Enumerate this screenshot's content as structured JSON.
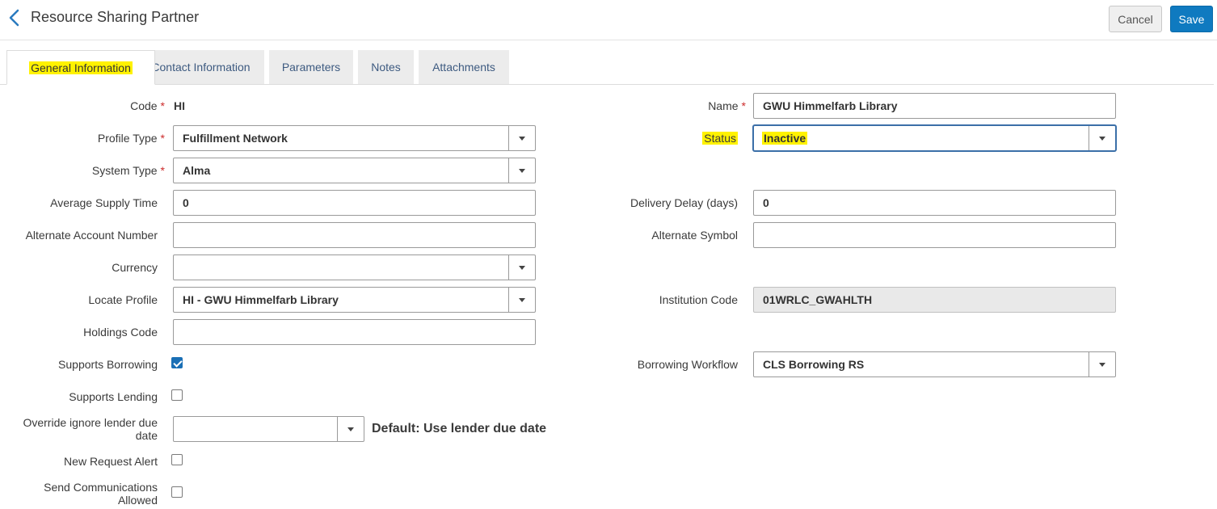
{
  "header": {
    "title": "Resource Sharing Partner",
    "back_icon": "chevron-left-icon",
    "cancel_label": "Cancel",
    "save_label": "Save"
  },
  "tabs": [
    {
      "label": "General Information",
      "active": true
    },
    {
      "label": "Contact Information"
    },
    {
      "label": "Parameters"
    },
    {
      "label": "Notes"
    },
    {
      "label": "Attachments"
    }
  ],
  "form": {
    "code": {
      "label": "Code",
      "value": "HI",
      "required": "*"
    },
    "name": {
      "label": "Name",
      "value": "GWU Himmelfarb Library",
      "required": "*"
    },
    "profile_type": {
      "label": "Profile Type",
      "value": "Fulfillment Network",
      "required": "*"
    },
    "status": {
      "label": "Status",
      "value": "Inactive"
    },
    "system_type": {
      "label": "System Type",
      "value": "Alma",
      "required": "*"
    },
    "average_supply_time": {
      "label": "Average Supply Time",
      "value": "0"
    },
    "delivery_delay": {
      "label": "Delivery Delay (days)",
      "value": "0"
    },
    "alternate_account_number": {
      "label": "Alternate Account Number",
      "value": ""
    },
    "alternate_symbol": {
      "label": "Alternate Symbol",
      "value": ""
    },
    "currency": {
      "label": "Currency",
      "value": ""
    },
    "locate_profile": {
      "label": "Locate Profile",
      "value": "HI - GWU Himmelfarb Library"
    },
    "institution_code": {
      "label": "Institution Code",
      "value": "01WRLC_GWAHLTH"
    },
    "holdings_code": {
      "label": "Holdings Code",
      "value": ""
    },
    "supports_borrowing": {
      "label": "Supports Borrowing",
      "checked": true
    },
    "borrowing_workflow": {
      "label": "Borrowing Workflow",
      "value": "CLS Borrowing RS"
    },
    "supports_lending": {
      "label": "Supports Lending",
      "checked": false
    },
    "override_ignore_lender_due_date": {
      "label_line1": "Override ignore lender due",
      "label_line2": "date",
      "value": "",
      "note": "Default: Use lender due date"
    },
    "new_request_alert": {
      "label": "New Request Alert",
      "checked": false
    },
    "send_communications_allowed": {
      "label_line1": "Send Communications",
      "label_line2": "Allowed",
      "checked": false
    }
  },
  "colors": {
    "accent": "#0f7ac0",
    "highlight": "#fff200",
    "required": "#cc2b2b"
  }
}
